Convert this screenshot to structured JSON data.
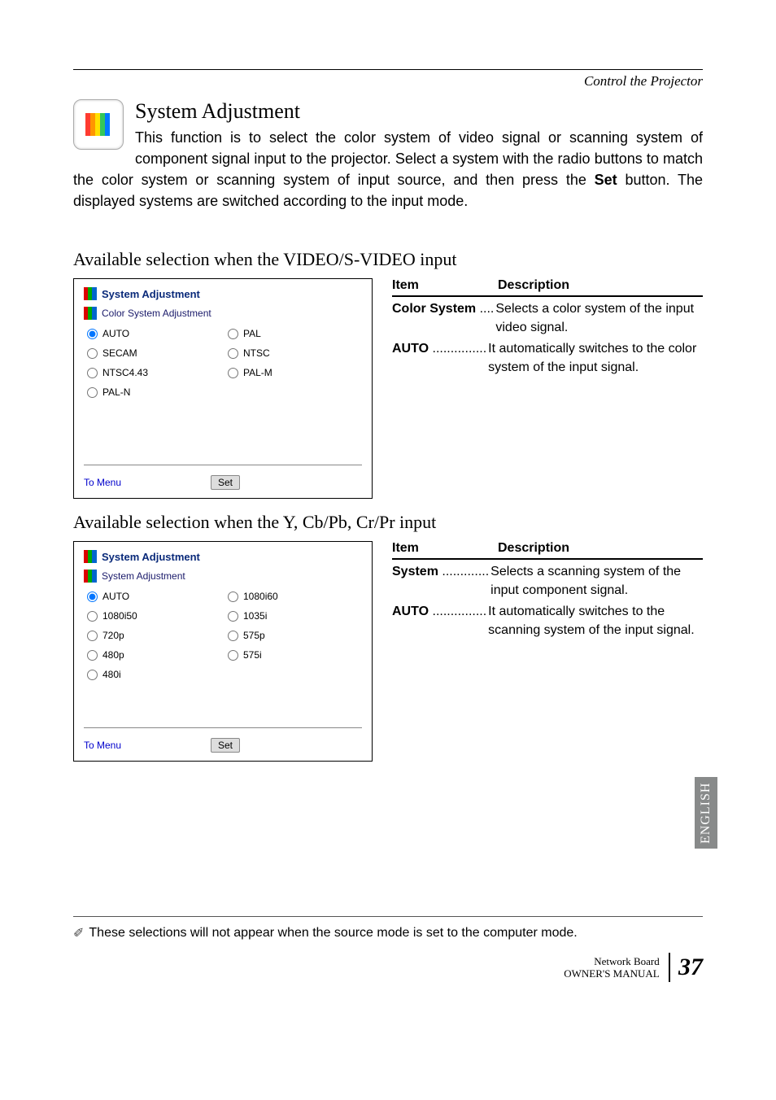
{
  "header": {
    "breadcrumb": "Control the Projector"
  },
  "section": {
    "title": "System Adjustment",
    "paragraph_prefix": "This function is to select the color system of video signal or scanning system of component signal input to the projector. Select a system with the radio buttons to match the color system or scanning system of input source, and then press the ",
    "set_word": "Set",
    "paragraph_suffix": " button. The displayed systems are switched according to the input mode."
  },
  "sub1": {
    "heading": "Available selection when the VIDEO/S-VIDEO input",
    "panel": {
      "title": "System Adjustment",
      "subtitle": "Color System Adjustment",
      "options_col1": [
        "AUTO",
        "SECAM",
        "NTSC4.43",
        "PAL-N"
      ],
      "options_col2": [
        "PAL",
        "NTSC",
        "PAL-M"
      ],
      "selected": "AUTO",
      "to_menu": "To Menu",
      "set": "Set"
    },
    "table": {
      "h_item": "Item",
      "h_desc": "Description",
      "rows": [
        {
          "leader_bold": "Color System",
          "dots": " ....",
          "text": "Selects a color system of the input video signal."
        },
        {
          "leader_bold": "AUTO",
          "dots": " ...............",
          "text": "It automatically switches to the color system of the input signal."
        }
      ]
    }
  },
  "sub2": {
    "heading": "Available selection when the Y, Cb/Pb, Cr/Pr input",
    "panel": {
      "title": "System Adjustment",
      "subtitle": "System Adjustment",
      "options_col1": [
        "AUTO",
        "1080i50",
        "720p",
        "480p",
        "480i"
      ],
      "options_col2": [
        "1080i60",
        "1035i",
        "575p",
        "575i"
      ],
      "selected": "AUTO",
      "to_menu": "To Menu",
      "set": "Set"
    },
    "table": {
      "h_item": "Item",
      "h_desc": "Description",
      "rows": [
        {
          "leader_bold": "System",
          "dots": " .............",
          "text": "Selects a scanning system of the input component signal."
        },
        {
          "leader_bold": "AUTO",
          "dots": " ...............",
          "text": "It automatically switches to the scanning system of the input signal."
        }
      ]
    }
  },
  "sidetab": "ENGLISH",
  "footnote": "These selections will not appear when the source mode is set to the computer mode.",
  "footer": {
    "line1": "Network Board",
    "line2": "OWNER'S MANUAL",
    "page": "37"
  }
}
